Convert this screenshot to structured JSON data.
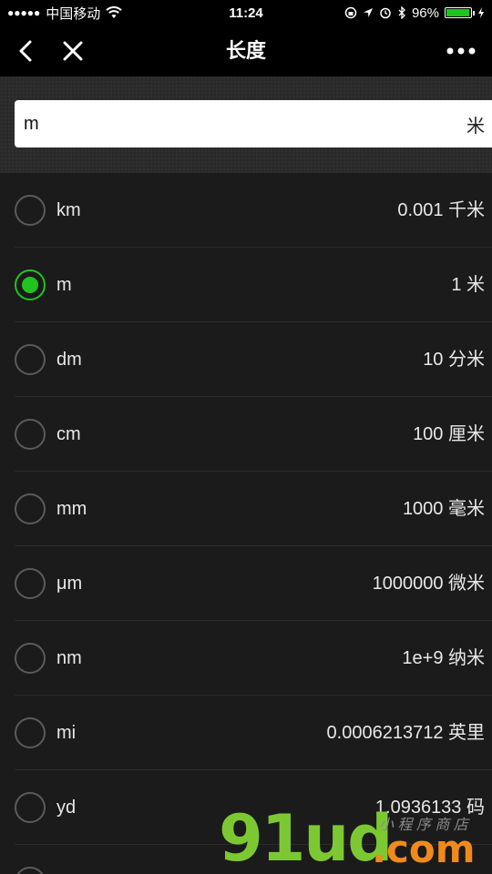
{
  "status_bar": {
    "carrier": "中国移动",
    "time": "11:24",
    "battery": "96%",
    "battery_level": 0.96
  },
  "nav": {
    "title": "长度"
  },
  "input": {
    "value": "m",
    "unit_label": "米"
  },
  "units": [
    {
      "abbr": "km",
      "value": "0.001 千米",
      "selected": false
    },
    {
      "abbr": "m",
      "value": "1 米",
      "selected": true
    },
    {
      "abbr": "dm",
      "value": "10 分米",
      "selected": false
    },
    {
      "abbr": "cm",
      "value": "100 厘米",
      "selected": false
    },
    {
      "abbr": "mm",
      "value": "1000 毫米",
      "selected": false
    },
    {
      "abbr": "μm",
      "value": "1000000 微米",
      "selected": false
    },
    {
      "abbr": "nm",
      "value": "1e+9 纳米",
      "selected": false
    },
    {
      "abbr": "mi",
      "value": "0.0006213712 英里",
      "selected": false
    },
    {
      "abbr": "yd",
      "value": "1.0936133 码",
      "selected": false
    }
  ],
  "watermark": {
    "main": "91ud",
    "suffix": ".com",
    "sub": "小 程 序 商 店"
  },
  "colors": {
    "accent": "#21c41e",
    "background": "#1b1b1b"
  }
}
